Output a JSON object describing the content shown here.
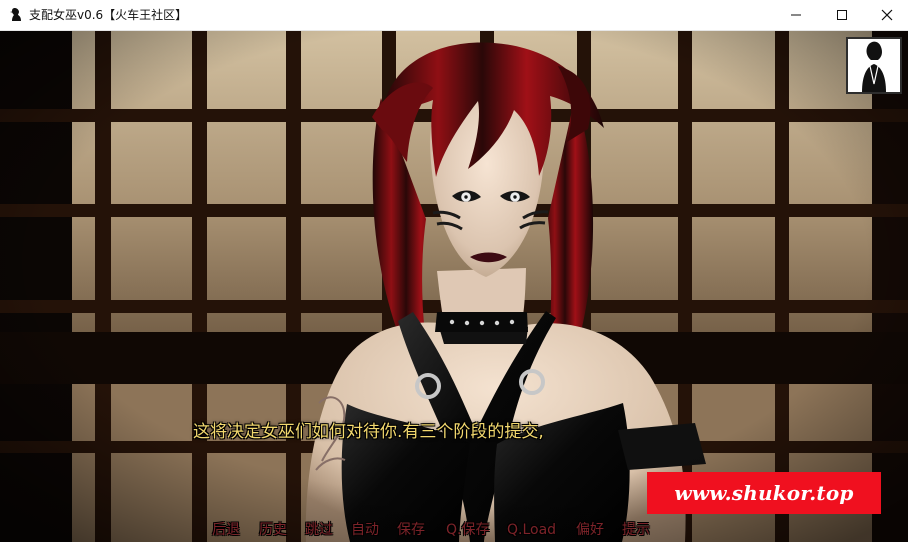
{
  "window": {
    "title": "支配女巫v0.6【火车王社区】",
    "app_icon": "raven-icon",
    "controls": {
      "minimize_icon": "minimize-icon",
      "maximize_icon": "maximize-icon",
      "close_icon": "close-icon"
    }
  },
  "game": {
    "dialogue": "这将决定女巫们如何对待你.有三个阶段的提交,",
    "portrait_icon": "character-portrait-icon",
    "watermark": "www.shukor.top",
    "quick_menu": [
      "后退",
      "历史",
      "跳过",
      "自动",
      "保存",
      "Q.保存",
      "Q.Load",
      "偏好",
      "提示"
    ]
  },
  "colors": {
    "titlebar_bg": "#ffffff",
    "dialogue_text": "#f2d86e",
    "quick_menu_text": "#7c2329",
    "watermark_bg": "#f0101f",
    "watermark_text": "#ffffff",
    "screen_bg": "#120b07"
  }
}
